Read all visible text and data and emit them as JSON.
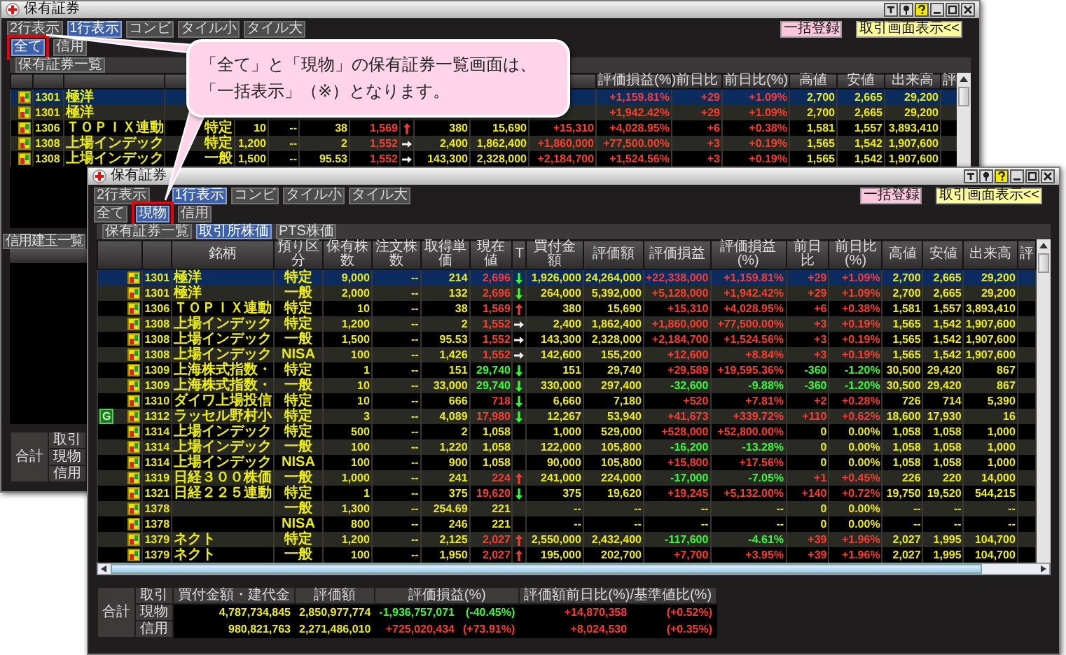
{
  "back_window": {
    "title": "保有証券",
    "view_buttons": [
      {
        "label": "2行表示",
        "selected": false
      },
      {
        "label": "1行表示",
        "selected": true
      },
      {
        "label": "コンビ",
        "selected": false
      },
      {
        "label": "タイル小",
        "selected": false
      },
      {
        "label": "タイル大",
        "selected": false
      }
    ],
    "filter_buttons": [
      {
        "label": "全て",
        "selected": true,
        "highlighted": true
      },
      {
        "label": "信用",
        "selected": false,
        "highlighted": false
      }
    ],
    "actions": [
      {
        "label": "一括登録",
        "kind": "register"
      },
      {
        "label": "取引画面表示<<",
        "kind": "trade"
      }
    ],
    "tabs": [
      {
        "label": "保有証券一覧",
        "selected": false
      }
    ],
    "table": {
      "header": {
        "pl_pct": "評価損益(%)",
        "day": "前日比",
        "day_pct": "前日比(%)",
        "high": "高値",
        "low": "安値",
        "volume": "出来高",
        "column_19": "評"
      },
      "rows": [
        {
          "selected": true,
          "code": "1301",
          "name": "極洋",
          "pl_pct": "+1,159.81%",
          "day": "+29",
          "day_pct": "+1.09%",
          "high": "2,700",
          "low": "2,665",
          "volume": "29,200",
          "pl_gain": true,
          "day_gain": true
        },
        {
          "selected": false,
          "code": "1301",
          "name": "極洋",
          "pl_pct": "+1,942.42%",
          "day": "+29",
          "day_pct": "+1.09%",
          "high": "2,700",
          "low": "2,665",
          "volume": "29,200",
          "pl_gain": true,
          "day_gain": true
        },
        {
          "selected": false,
          "code": "1306",
          "name": "ＴＯＰＩＸ連動",
          "account": "特定",
          "shares": "10",
          "ordered": "--",
          "cost": "38",
          "price": "1,569",
          "tick": {
            "kind": "up"
          },
          "buy_amount": "380",
          "value": "15,690",
          "pl": "+15,310",
          "pl_pct": "+4,028.95%",
          "day": "+6",
          "day_pct": "+0.38%",
          "high": "1,581",
          "low": "1,557",
          "volume": "3,893,410",
          "pl_gain": true,
          "day_gain": true
        },
        {
          "selected": false,
          "code": "1308",
          "name": "上場インデック",
          "account": "特定",
          "shares": "1,200",
          "ordered": "--",
          "cost": "2",
          "price": "1,552",
          "tick": {
            "kind": "flat"
          },
          "buy_amount": "2,400",
          "value": "1,862,400",
          "pl": "+1,860,000",
          "pl_pct": "+77,500.00%",
          "day": "+3",
          "day_pct": "+0.19%",
          "high": "1,565",
          "low": "1,542",
          "volume": "1,907,600",
          "pl_gain": true,
          "day_gain": true
        },
        {
          "selected": false,
          "code": "1308",
          "name": "上場インデック",
          "account": "一般",
          "shares": "1,500",
          "ordered": "--",
          "cost": "95.53",
          "price": "1,552",
          "tick": {
            "kind": "flat"
          },
          "buy_amount": "143,300",
          "value": "2,328,000",
          "pl": "+2,184,700",
          "pl_pct": "+1,524.56%",
          "day": "+3",
          "day_pct": "+0.19%",
          "high": "1,565",
          "low": "1,542",
          "volume": "1,907,600",
          "pl_gain": true,
          "day_gain": true
        }
      ]
    },
    "margin_tab": {
      "label": "信用建玉一覧",
      "selected": false
    },
    "summary": {
      "label": "合計",
      "header": {
        "label": "取引"
      },
      "rows": [
        {
          "label": "現物"
        },
        {
          "label": "信用"
        }
      ]
    }
  },
  "front_window": {
    "title": "保有証券",
    "view_buttons": [
      {
        "label": "2行表示",
        "selected": false
      },
      {
        "label": "1行表示",
        "selected": true
      },
      {
        "label": "コンビ",
        "selected": false
      },
      {
        "label": "タイル小",
        "selected": false
      },
      {
        "label": "タイル大",
        "selected": false
      }
    ],
    "filter_buttons": [
      {
        "label": "全て",
        "selected": false,
        "highlighted": false
      },
      {
        "label": "現物",
        "selected": true,
        "highlighted": true
      },
      {
        "label": "信用",
        "selected": false,
        "highlighted": false
      }
    ],
    "actions": [
      {
        "label": "一括登録",
        "kind": "register"
      },
      {
        "label": "取引画面表示<<",
        "kind": "trade"
      }
    ],
    "tabs": [
      {
        "label": "保有証券一覧",
        "selected": false
      },
      {
        "label": "取引所株価",
        "selected": true
      },
      {
        "label": "PTS株価",
        "selected": false
      }
    ],
    "table": {
      "header": {
        "name": "銘柄",
        "account": "預り区分",
        "shares": "保有株数",
        "ordered": "注文株数",
        "cost": "取得単価",
        "price": "現在値",
        "tick": "T",
        "buy_amount": "買付金額",
        "value": "評価額",
        "pl": "評価損益",
        "pl_pct": "評価損益(%)",
        "day": "前日比",
        "day_pct": "前日比(%)",
        "high": "高値",
        "low": "安値",
        "volume": "出来高",
        "column_19": "評"
      },
      "rows": [
        {
          "selected": true,
          "code": "1301",
          "name": "極洋",
          "account": "特定",
          "shares": "9,000",
          "ordered": "--",
          "cost": "214",
          "price": "2,696",
          "tick": {
            "kind": "down"
          },
          "buy_amount": "1,926,000",
          "value": "24,264,000",
          "pl": "+22,338,000",
          "pl_pct": "+1,159.81%",
          "day": "+29",
          "day_pct": "+1.09%",
          "high": "2,700",
          "low": "2,665",
          "volume": "29,200",
          "pl_gain": true,
          "day_gain": true
        },
        {
          "selected": false,
          "code": "1301",
          "name": "極洋",
          "account": "一般",
          "shares": "2,000",
          "ordered": "--",
          "cost": "132",
          "price": "2,696",
          "tick": {
            "kind": "down"
          },
          "buy_amount": "264,000",
          "value": "5,392,000",
          "pl": "+5,128,000",
          "pl_pct": "+1,942.42%",
          "day": "+29",
          "day_pct": "+1.09%",
          "high": "2,700",
          "low": "2,665",
          "volume": "29,200",
          "pl_gain": true,
          "day_gain": true
        },
        {
          "selected": false,
          "code": "1306",
          "name": "ＴＯＰＩＸ連動",
          "account": "特定",
          "shares": "10",
          "ordered": "--",
          "cost": "38",
          "price": "1,569",
          "tick": {
            "kind": "up"
          },
          "buy_amount": "380",
          "value": "15,690",
          "pl": "+15,310",
          "pl_pct": "+4,028.95%",
          "day": "+6",
          "day_pct": "+0.38%",
          "high": "1,581",
          "low": "1,557",
          "volume": "3,893,410",
          "pl_gain": true,
          "day_gain": true
        },
        {
          "selected": false,
          "code": "1308",
          "name": "上場インデック",
          "account": "特定",
          "shares": "1,200",
          "ordered": "--",
          "cost": "2",
          "price": "1,552",
          "tick": {
            "kind": "flat"
          },
          "buy_amount": "2,400",
          "value": "1,862,400",
          "pl": "+1,860,000",
          "pl_pct": "+77,500.00%",
          "day": "+3",
          "day_pct": "+0.19%",
          "high": "1,565",
          "low": "1,542",
          "volume": "1,907,600",
          "pl_gain": true,
          "day_gain": true
        },
        {
          "selected": false,
          "code": "1308",
          "name": "上場インデック",
          "account": "一般",
          "shares": "1,500",
          "ordered": "--",
          "cost": "95.53",
          "price": "1,552",
          "tick": {
            "kind": "flat"
          },
          "buy_amount": "143,300",
          "value": "2,328,000",
          "pl": "+2,184,700",
          "pl_pct": "+1,524.56%",
          "day": "+3",
          "day_pct": "+0.19%",
          "high": "1,565",
          "low": "1,542",
          "volume": "1,907,600",
          "pl_gain": true,
          "day_gain": true
        },
        {
          "selected": false,
          "code": "1308",
          "name": "上場インデック",
          "account": "NISA",
          "shares": "100",
          "ordered": "--",
          "cost": "1,426",
          "price": "1,552",
          "tick": {
            "kind": "flat"
          },
          "buy_amount": "142,600",
          "value": "155,200",
          "pl": "+12,600",
          "pl_pct": "+8.84%",
          "day": "+3",
          "day_pct": "+0.19%",
          "high": "1,565",
          "low": "1,542",
          "volume": "1,907,600",
          "pl_gain": true,
          "day_gain": true
        },
        {
          "selected": false,
          "code": "1309",
          "name": "上海株式指数・",
          "account": "特定",
          "shares": "1",
          "ordered": "--",
          "cost": "151",
          "price": "29,740",
          "tick": {
            "kind": "down"
          },
          "buy_amount": "151",
          "value": "29,740",
          "pl": "+29,589",
          "pl_pct": "+19,595.36%",
          "day": "-360",
          "day_pct": "-1.20%",
          "high": "30,500",
          "low": "29,420",
          "volume": "867",
          "pl_gain": true,
          "day_gain": false
        },
        {
          "selected": false,
          "code": "1309",
          "name": "上海株式指数・",
          "account": "一般",
          "shares": "10",
          "ordered": "--",
          "cost": "33,000",
          "price": "29,740",
          "tick": {
            "kind": "down"
          },
          "buy_amount": "330,000",
          "value": "297,400",
          "pl": "-32,600",
          "pl_pct": "-9.88%",
          "day": "-360",
          "day_pct": "-1.20%",
          "high": "30,500",
          "low": "29,420",
          "volume": "867",
          "pl_gain": false,
          "day_gain": false
        },
        {
          "selected": false,
          "code": "1310",
          "name": "ダイワ上場投信",
          "account": "特定",
          "shares": "10",
          "ordered": "--",
          "cost": "666",
          "price": "718",
          "tick": {
            "kind": "down"
          },
          "buy_amount": "6,660",
          "value": "7,180",
          "pl": "+520",
          "pl_pct": "+7.81%",
          "day": "+2",
          "day_pct": "+0.28%",
          "high": "726",
          "low": "714",
          "volume": "5,390",
          "pl_gain": true,
          "day_gain": true
        },
        {
          "selected": false,
          "badge": "G",
          "code": "1312",
          "name": "ラッセル野村小",
          "account": "特定",
          "shares": "3",
          "ordered": "--",
          "cost": "4,089",
          "price": "17,980",
          "tick": {
            "kind": "down"
          },
          "buy_amount": "12,267",
          "value": "53,940",
          "pl": "+41,673",
          "pl_pct": "+339.72%",
          "day": "+110",
          "day_pct": "+0.62%",
          "high": "18,600",
          "low": "17,930",
          "volume": "16",
          "pl_gain": true,
          "day_gain": true
        },
        {
          "selected": false,
          "code": "1314",
          "name": "上場インデック",
          "account": "特定",
          "shares": "500",
          "ordered": "--",
          "cost": "2",
          "price": "1,058",
          "buy_amount": "1,000",
          "value": "529,000",
          "pl": "+528,000",
          "pl_pct": "+52,800.00%",
          "day": "0",
          "day_pct": "0.00%",
          "high": "1,058",
          "low": "1,058",
          "volume": "1,000",
          "pl_gain": true
        },
        {
          "selected": false,
          "code": "1314",
          "name": "上場インデック",
          "account": "一般",
          "shares": "100",
          "ordered": "--",
          "cost": "1,220",
          "price": "1,058",
          "buy_amount": "122,000",
          "value": "105,800",
          "pl": "-16,200",
          "pl_pct": "-13.28%",
          "day": "0",
          "day_pct": "0.00%",
          "high": "1,058",
          "low": "1,058",
          "volume": "1,000",
          "pl_gain": false
        },
        {
          "selected": false,
          "code": "1314",
          "name": "上場インデック",
          "account": "NISA",
          "shares": "100",
          "ordered": "--",
          "cost": "900",
          "price": "1,058",
          "buy_amount": "90,000",
          "value": "105,800",
          "pl": "+15,800",
          "pl_pct": "+17.56%",
          "day": "0",
          "day_pct": "0.00%",
          "high": "1,058",
          "low": "1,058",
          "volume": "1,000",
          "pl_gain": true
        },
        {
          "selected": false,
          "code": "1319",
          "name": "日経３００株価",
          "account": "一般",
          "shares": "1,000",
          "ordered": "--",
          "cost": "241",
          "price": "224",
          "tick": {
            "kind": "up"
          },
          "buy_amount": "241,000",
          "value": "224,000",
          "pl": "-17,000",
          "pl_pct": "-7.05%",
          "day": "+1",
          "day_pct": "+0.45%",
          "high": "226",
          "low": "220",
          "volume": "14,000",
          "pl_gain": false,
          "day_gain": true
        },
        {
          "selected": false,
          "code": "1321",
          "name": "日経２２５連動",
          "account": "特定",
          "shares": "1",
          "ordered": "--",
          "cost": "375",
          "price": "19,620",
          "tick": {
            "kind": "down"
          },
          "buy_amount": "375",
          "value": "19,620",
          "pl": "+19,245",
          "pl_pct": "+5,132.00%",
          "day": "+140",
          "day_pct": "+0.72%",
          "high": "19,750",
          "low": "19,520",
          "volume": "544,215",
          "pl_gain": true,
          "day_gain": true
        },
        {
          "selected": false,
          "code": "1378",
          "account": "一般",
          "shares": "1,300",
          "ordered": "--",
          "cost": "254.69",
          "price": "221",
          "buy_amount": "--",
          "value": "--",
          "pl": "--",
          "pl_pct": "--",
          "day": "0",
          "day_pct": "0.00%",
          "high": "--",
          "low": "--",
          "volume": "--"
        },
        {
          "selected": false,
          "code": "1378",
          "account": "NISA",
          "shares": "800",
          "ordered": "--",
          "cost": "246",
          "price": "221",
          "buy_amount": "--",
          "value": "--",
          "pl": "--",
          "pl_pct": "--",
          "day": "0",
          "day_pct": "0.00%",
          "high": "--",
          "low": "--",
          "volume": "--"
        },
        {
          "selected": false,
          "code": "1379",
          "name": "ネクト",
          "account": "特定",
          "shares": "1,200",
          "ordered": "--",
          "cost": "2,125",
          "price": "2,027",
          "tick": {
            "kind": "up"
          },
          "buy_amount": "2,550,000",
          "value": "2,432,400",
          "pl": "-117,600",
          "pl_pct": "-4.61%",
          "day": "+39",
          "day_pct": "+1.96%",
          "high": "2,027",
          "low": "1,995",
          "volume": "104,700",
          "pl_gain": false,
          "day_gain": true
        },
        {
          "selected": false,
          "code": "1379",
          "name": "ネクト",
          "account": "一般",
          "shares": "100",
          "ordered": "--",
          "cost": "1,950",
          "price": "2,027",
          "tick": {
            "kind": "up"
          },
          "buy_amount": "195,000",
          "value": "202,700",
          "pl": "+7,700",
          "pl_pct": "+3.95%",
          "day": "+39",
          "day_pct": "+1.96%",
          "high": "2,027",
          "low": "1,995",
          "volume": "104,700",
          "pl_gain": true,
          "day_gain": true
        }
      ]
    },
    "summary": {
      "label": "合計",
      "header": {
        "label": "取引",
        "buy_amount": "買付金額・建代金",
        "value": "評価額",
        "pl": "評価損益(%)",
        "day": "評価額前日比(%)/基準値比(%)"
      },
      "rows": [
        {
          "label": "現物",
          "buy_amount": "4,787,734,845",
          "value": "2,850,977,774",
          "pl": "-1,936,757,071",
          "pl_pct": "(-40.45%)",
          "day": "+14,870,358",
          "day_pct": "(+0.52%)",
          "pl_gain": false,
          "day_gain": true
        },
        {
          "label": "信用",
          "buy_amount": "980,821,763",
          "value": "2,271,486,010",
          "pl": "+725,020,434",
          "pl_pct": "(+73.91%)",
          "day": "+8,024,530",
          "day_pct": "(+0.35%)",
          "pl_gain": true,
          "day_gain": true
        }
      ]
    }
  },
  "callout": {
    "lines": [
      "「全て」と「現物」の保有証券一覧画面は、",
      "「一括表示」（※）となります。"
    ]
  }
}
